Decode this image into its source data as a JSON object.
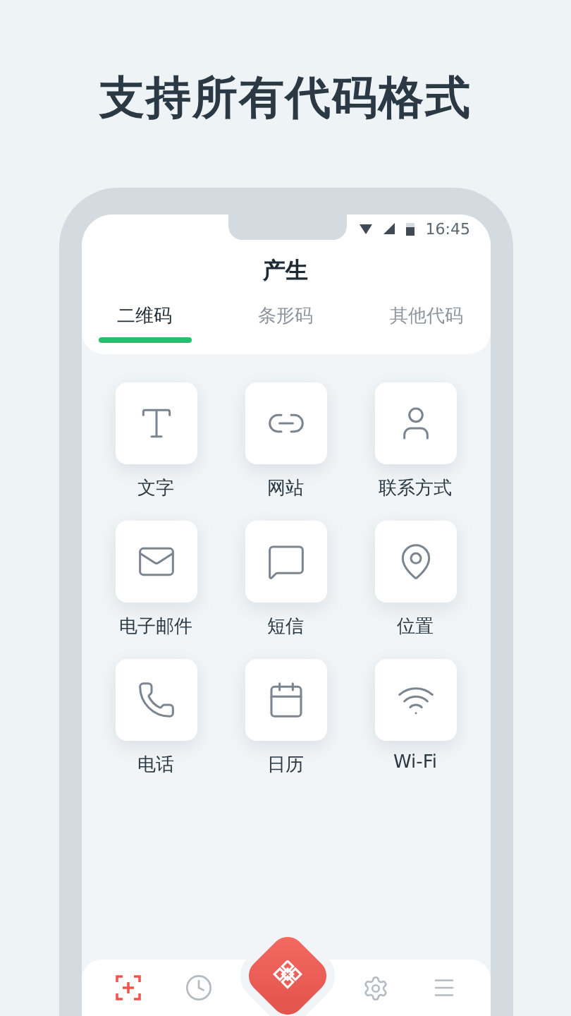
{
  "headline": "支持所有代码格式",
  "status_bar": {
    "time": "16:45"
  },
  "app_bar": {
    "title": "产生"
  },
  "tabs": [
    {
      "label": "二维码",
      "selected": true
    },
    {
      "label": "条形码",
      "selected": false
    },
    {
      "label": "其他代码",
      "selected": false
    }
  ],
  "grid": [
    {
      "kind": "text",
      "label": "文字"
    },
    {
      "kind": "link",
      "label": "网站"
    },
    {
      "kind": "contact",
      "label": "联系方式"
    },
    {
      "kind": "email",
      "label": "电子邮件"
    },
    {
      "kind": "sms",
      "label": "短信"
    },
    {
      "kind": "location",
      "label": "位置"
    },
    {
      "kind": "phone",
      "label": "电话"
    },
    {
      "kind": "calendar",
      "label": "日历"
    },
    {
      "kind": "wifi",
      "label": "Wi-Fi"
    }
  ],
  "bottom_nav": [
    {
      "kind": "scan",
      "selected": true
    },
    {
      "kind": "history",
      "selected": false
    },
    {
      "kind": "create",
      "selected": false
    },
    {
      "kind": "settings",
      "selected": false
    },
    {
      "kind": "menu",
      "selected": false
    }
  ]
}
